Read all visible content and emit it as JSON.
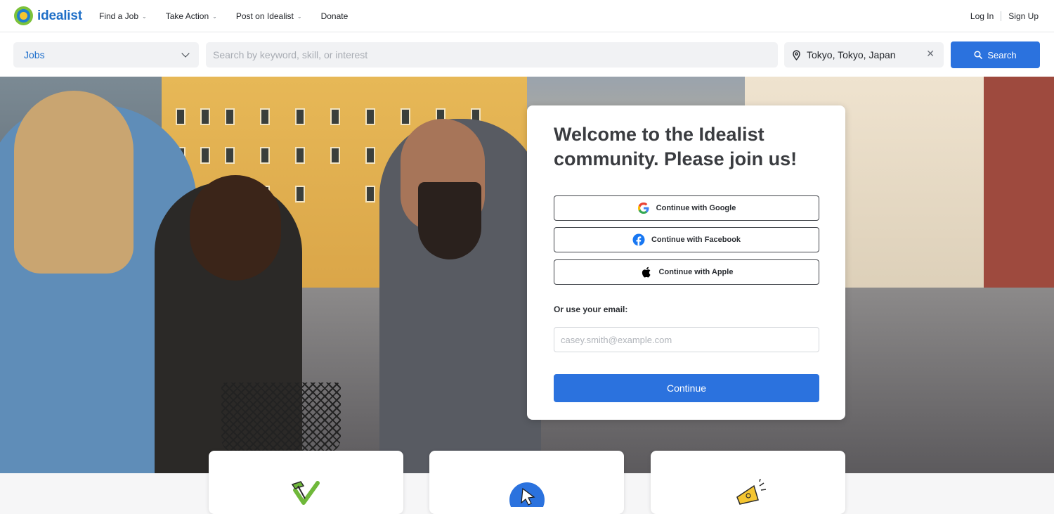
{
  "brand": {
    "name": "idealist"
  },
  "nav": {
    "items": [
      {
        "label": "Find a Job",
        "has_menu": true
      },
      {
        "label": "Take Action",
        "has_menu": true
      },
      {
        "label": "Post on Idealist",
        "has_menu": true
      },
      {
        "label": "Donate",
        "has_menu": false
      }
    ],
    "login": "Log In",
    "signup": "Sign Up"
  },
  "search": {
    "type_selected": "Jobs",
    "keyword_placeholder": "Search by keyword, skill, or interest",
    "location_value": "Tokyo, Tokyo, Japan",
    "button_label": "Search"
  },
  "signup_card": {
    "heading": "Welcome to the Idealist community. Please join us!",
    "google_label": "Continue with Google",
    "facebook_label": "Continue with Facebook",
    "apple_label": "Continue with Apple",
    "or_email_label": "Or use your email:",
    "email_placeholder": "casey.smith@example.com",
    "continue_label": "Continue"
  },
  "feature_cards": [
    {
      "icon": "hammer-check-icon"
    },
    {
      "icon": "cursor-badge-icon"
    },
    {
      "icon": "megaphone-icon"
    }
  ],
  "colors": {
    "primary": "#2b72de",
    "brand_blue": "#1f6fc7",
    "brand_green": "#7cc23a",
    "brand_yellow": "#f4c531"
  }
}
